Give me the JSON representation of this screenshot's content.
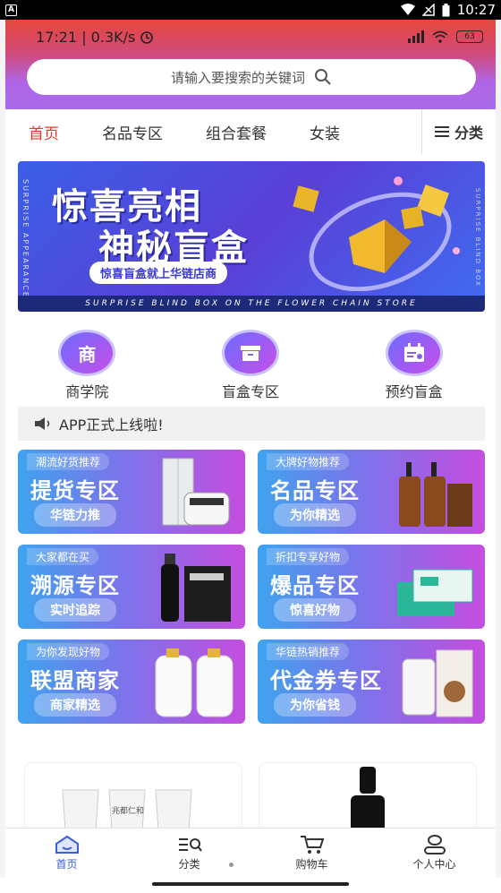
{
  "system_bar": {
    "time": "10:27"
  },
  "inner_status": {
    "text": "17:21 | 0.3K/s",
    "battery": "63"
  },
  "search": {
    "placeholder": "请输入要搜索的关键词"
  },
  "tabs": [
    {
      "label": "首页",
      "active": true
    },
    {
      "label": "名品专区",
      "active": false
    },
    {
      "label": "组合套餐",
      "active": false
    },
    {
      "label": "女装",
      "active": false
    }
  ],
  "category_button": "分类",
  "banner": {
    "line1": "惊喜亮相",
    "line2": "神秘盲盒",
    "tag": "惊喜盲盒就上华链店商",
    "side_left": "SURPRISE APPEARANCE",
    "side_right": "SURPRISE BLIND BOX",
    "footer": "SURPRISE BLIND BOX ON THE FLOWER CHAIN STORE",
    "slide_index": 1,
    "slide_count": 3
  },
  "shortcuts": [
    {
      "icon_text": "商",
      "label": "商学院",
      "icon": "shop-icon"
    },
    {
      "icon_text": "▭",
      "label": "盲盒专区",
      "icon": "box-icon"
    },
    {
      "icon_text": "▦",
      "label": "预约盲盒",
      "icon": "calendar-icon"
    }
  ],
  "notice": {
    "text": "APP正式上线啦!"
  },
  "zones": [
    {
      "sub": "潮流好货推荐",
      "title": "提货专区",
      "pill": "华链力推"
    },
    {
      "sub": "大牌好物推荐",
      "title": "名品专区",
      "pill": "为你精选"
    },
    {
      "sub": "大家都在买",
      "title": "溯源专区",
      "pill": "实时追踪"
    },
    {
      "sub": "折扣专享好物",
      "title": "爆品专区",
      "pill": "惊喜好物"
    },
    {
      "sub": "为你发现好物",
      "title": "联盟商家",
      "pill": "商家精选"
    },
    {
      "sub": "华链热销推荐",
      "title": "代金券专区",
      "pill": "为你省钱"
    }
  ],
  "product_text": "兆都仁和",
  "bottom_nav": [
    {
      "label": "首页",
      "icon": "home-icon",
      "active": true
    },
    {
      "label": "分类",
      "icon": "category-icon",
      "active": false
    },
    {
      "label": "购物车",
      "icon": "cart-icon",
      "active": false
    },
    {
      "label": "个人中心",
      "icon": "user-icon",
      "active": false
    }
  ],
  "colors": {
    "accent_red": "#e0392c",
    "nav_active": "#3a5fd6",
    "header_top": "#e8473c",
    "header_bottom": "#a86be8"
  }
}
